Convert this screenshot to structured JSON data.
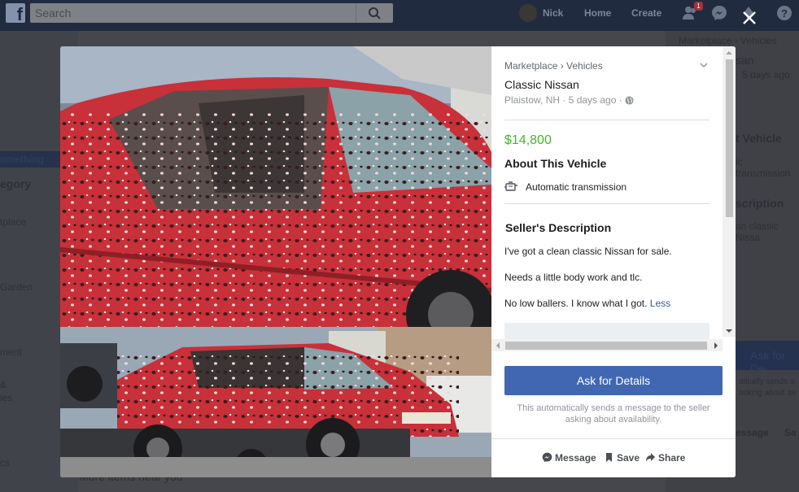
{
  "topbar": {
    "search_placeholder": "Search",
    "user_name": "Nick",
    "home_label": "Home",
    "create_label": "Create",
    "friend_requests_count": "1"
  },
  "background": {
    "left_items": [
      "omething",
      "egory",
      "tplace",
      "Garden",
      "ment",
      "&",
      "ies",
      "cs"
    ],
    "right_items": [
      "Marketplace › Vehicles",
      "san",
      "5 days ago",
      "t Vehicle",
      "ic transmission",
      "scription",
      "an classic Nissa",
      "Ask for De",
      "atically sends a",
      "asking about av",
      "essage",
      "Sa"
    ],
    "bottom_text": "More items near you"
  },
  "listing": {
    "breadcrumb": "Marketplace › Vehicles",
    "title": "Classic Nissan",
    "meta": "Plaistow, NH · 5 days ago ·",
    "price": "$14,800",
    "about_heading": "About This Vehicle",
    "transmission": "Automatic transmission",
    "description_heading": "Seller's Description",
    "description_lines": [
      "I've got a clean classic Nissan for sale.",
      "Needs a little body work and tlc.",
      "No low ballers. I know what I got."
    ],
    "less_link": "Less"
  },
  "cta": {
    "ask_label": "Ask for Details",
    "note": "This automatically sends a message to the seller asking about availability."
  },
  "actions": {
    "message": "Message",
    "save": "Save",
    "share": "Share"
  },
  "colors": {
    "price_green": "#42b72a",
    "fb_blue": "#4267b2",
    "link_blue": "#385898",
    "car_red": "#c8303a"
  },
  "icons": [
    "facebook-logo-icon",
    "search-icon",
    "friends-icon",
    "messenger-icon",
    "notifications-icon",
    "help-icon",
    "close-icon",
    "chevron-down-icon",
    "globe-icon",
    "transmission-icon",
    "messenger-icon",
    "bookmark-icon",
    "share-icon"
  ]
}
